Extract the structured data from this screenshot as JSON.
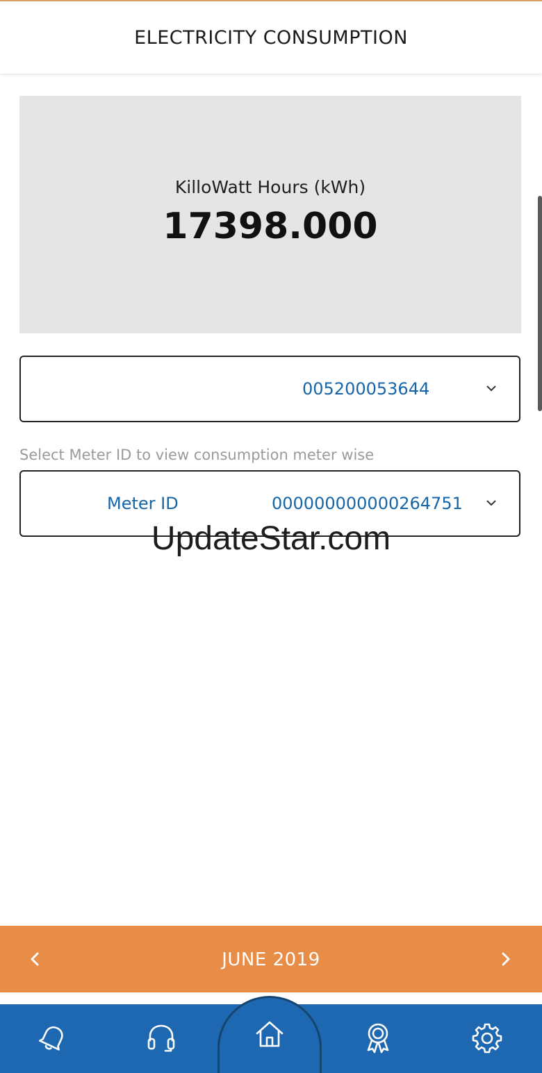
{
  "header": {
    "title": "ELECTRICITY CONSUMPTION"
  },
  "summary": {
    "label": "KilloWatt Hours (kWh)",
    "value": "17398.000"
  },
  "account_dropdown": {
    "value": "005200053644",
    "icon": "chevron-down-icon"
  },
  "meter_hint": "Select Meter ID to view consumption meter wise",
  "meter_dropdown": {
    "label": "Meter ID",
    "value": "000000000000264751",
    "icon": "chevron-down-icon"
  },
  "watermark": "UpdateStar.com",
  "month_selector": {
    "label": "JUNE 2019",
    "prev_icon": "chevron-left-icon",
    "next_icon": "chevron-right-icon"
  },
  "bottom_nav": {
    "items": [
      {
        "icon": "bell-icon"
      },
      {
        "icon": "headset-icon"
      },
      {
        "icon": "home-icon",
        "active": true
      },
      {
        "icon": "award-icon"
      },
      {
        "icon": "gear-icon"
      }
    ]
  },
  "colors": {
    "accent_orange": "#e88d47",
    "nav_blue": "#1e68b2",
    "value_blue": "#1565a8",
    "card_gray": "#e5e5e5"
  }
}
